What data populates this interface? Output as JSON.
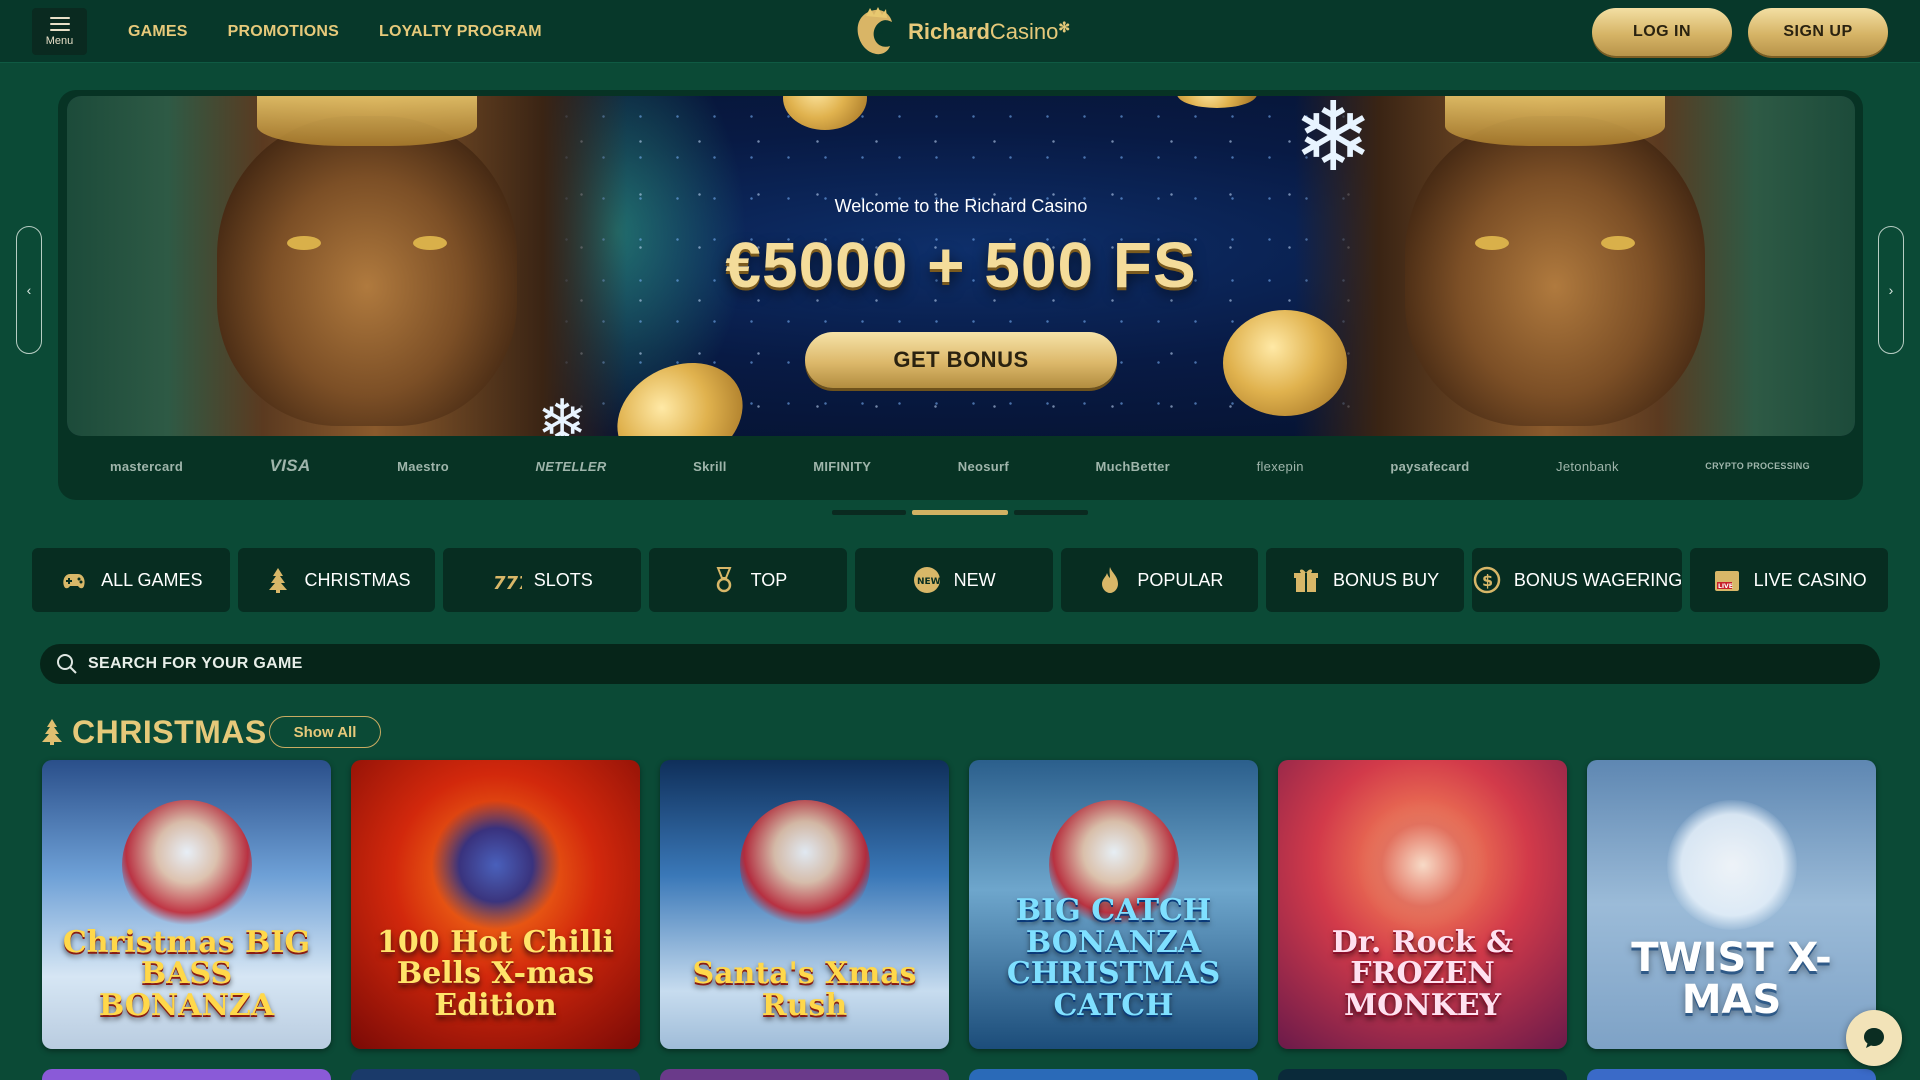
{
  "header": {
    "menu_label": "Menu",
    "nav": [
      "GAMES",
      "PROMOTIONS",
      "LOYALTY PROGRAM"
    ],
    "brand_bold": "Richard",
    "brand_light": "Casino",
    "login": "LOG IN",
    "signup": "SIGN UP"
  },
  "hero": {
    "welcome": "Welcome to the Richard Casino",
    "offer": "€5000 + 500 FS",
    "cta": "GET BONUS",
    "active_slide": 2,
    "slide_count": 3
  },
  "payments": [
    "mastercard",
    "VISA",
    "Maestro",
    "NETELLER",
    "Skrill",
    "MIFINITY",
    "Neosurf",
    "MuchBetter",
    "flexepin",
    "paysafecard",
    "Jetonbank",
    "CRYPTO PROCESSING"
  ],
  "categories": [
    {
      "label": "ALL GAMES",
      "icon": "gamepad-icon"
    },
    {
      "label": "CHRISTMAS",
      "icon": "christmas-tree-icon"
    },
    {
      "label": "SLOTS",
      "icon": "slots-777-icon"
    },
    {
      "label": "TOP",
      "icon": "medal-icon"
    },
    {
      "label": "NEW",
      "icon": "new-badge-icon"
    },
    {
      "label": "POPULAR",
      "icon": "flame-icon"
    },
    {
      "label": "BONUS BUY",
      "icon": "gift-icon"
    },
    {
      "label": "BONUS WAGERING",
      "icon": "coin-cycle-icon"
    },
    {
      "label": "LIVE CASINO",
      "icon": "live-casino-icon"
    }
  ],
  "search": {
    "placeholder": "SEARCH FOR YOUR GAME"
  },
  "section": {
    "title": "CHRISTMAS",
    "show_all": "Show All",
    "games": [
      {
        "title": "Christmas BIG BASS BONANZA"
      },
      {
        "title": "100 Hot Chilli Bells X-mas Edition"
      },
      {
        "title": "Santa's Xmas Rush"
      },
      {
        "title": "BIG CATCH BONANZA CHRISTMAS CATCH"
      },
      {
        "title": "Dr. Rock & FROZEN MONKEY"
      },
      {
        "title": "TWIST X-MAS"
      }
    ]
  },
  "colors": {
    "background": "#0b4a36",
    "header": "#07382a",
    "gold": "#e6c97a",
    "tab_bg": "#072d21"
  }
}
